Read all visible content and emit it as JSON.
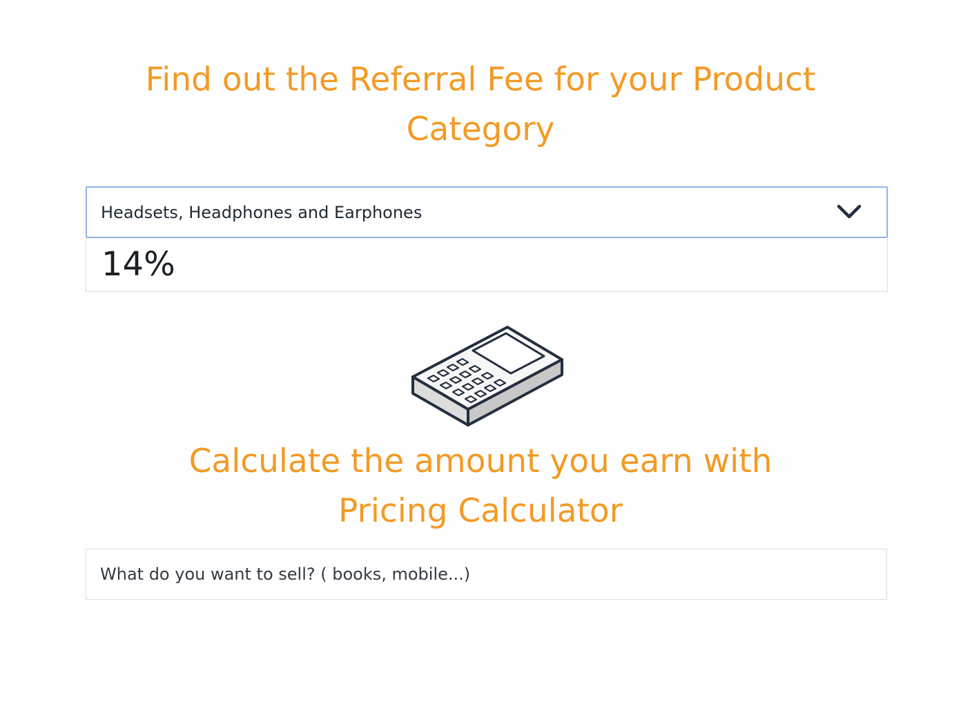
{
  "referral_section": {
    "heading_line1": "Find out the Referral Fee for your Product",
    "heading_line2": "Category",
    "category_select": {
      "selected_value": "Headsets, Headphones and Earphones",
      "icon": "chevron-down-icon"
    },
    "fee_percentage": "14%"
  },
  "calculator_section": {
    "icon": "calculator-icon",
    "heading_line1": "Calculate the amount you earn with",
    "heading_line2": "Pricing Calculator",
    "search": {
      "value": "",
      "placeholder": "What do you want to sell? ( books, mobile...)"
    }
  },
  "colors": {
    "accent": "#f39a25",
    "select_border": "#8fb4ea",
    "text": "#1f2a35",
    "border": "#dcdcdc"
  }
}
